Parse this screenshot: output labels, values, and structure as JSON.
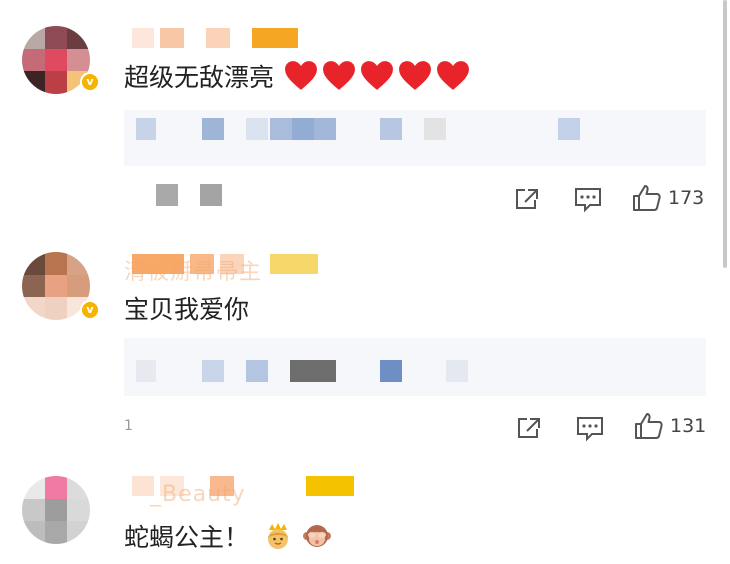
{
  "comments": [
    {
      "text": "超级无敌漂亮",
      "emoji": [
        "heart",
        "heart",
        "heart",
        "heart",
        "heart"
      ],
      "like_count": "173"
    },
    {
      "name_fragment": "清被掰帚帚主",
      "text": "宝贝我爱你",
      "reply_fragment": "1",
      "like_count": "131"
    },
    {
      "name_fragment": "_Beauty",
      "text": "蛇蝎公主！",
      "emoji": [
        "princess-emoji",
        "monkey-emoji"
      ]
    }
  ],
  "colors": {
    "heart": "#e8232a",
    "badge": "#f4b400",
    "icon": "#555555",
    "text": "#222222"
  },
  "icons": [
    "repost-icon",
    "comment-icon",
    "like-icon",
    "verified-badge-icon"
  ]
}
